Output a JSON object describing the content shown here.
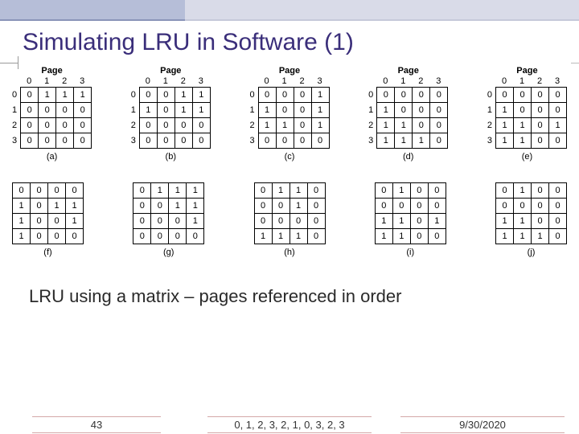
{
  "title": "Simulating LRU in Software (1)",
  "page_label": "Page",
  "cols": [
    "0",
    "1",
    "2",
    "3"
  ],
  "rows": [
    "0",
    "1",
    "2",
    "3"
  ],
  "matrices": {
    "top": [
      {
        "cap": "(a)",
        "m": [
          [
            "0",
            "1",
            "1",
            "1"
          ],
          [
            "0",
            "0",
            "0",
            "0"
          ],
          [
            "0",
            "0",
            "0",
            "0"
          ],
          [
            "0",
            "0",
            "0",
            "0"
          ]
        ]
      },
      {
        "cap": "(b)",
        "m": [
          [
            "0",
            "0",
            "1",
            "1"
          ],
          [
            "1",
            "0",
            "1",
            "1"
          ],
          [
            "0",
            "0",
            "0",
            "0"
          ],
          [
            "0",
            "0",
            "0",
            "0"
          ]
        ]
      },
      {
        "cap": "(c)",
        "m": [
          [
            "0",
            "0",
            "0",
            "1"
          ],
          [
            "1",
            "0",
            "0",
            "1"
          ],
          [
            "1",
            "1",
            "0",
            "1"
          ],
          [
            "0",
            "0",
            "0",
            "0"
          ]
        ]
      },
      {
        "cap": "(d)",
        "m": [
          [
            "0",
            "0",
            "0",
            "0"
          ],
          [
            "1",
            "0",
            "0",
            "0"
          ],
          [
            "1",
            "1",
            "0",
            "0"
          ],
          [
            "1",
            "1",
            "1",
            "0"
          ]
        ]
      },
      {
        "cap": "(e)",
        "m": [
          [
            "0",
            "0",
            "0",
            "0"
          ],
          [
            "1",
            "0",
            "0",
            "0"
          ],
          [
            "1",
            "1",
            "0",
            "1"
          ],
          [
            "1",
            "1",
            "0",
            "0"
          ]
        ]
      }
    ],
    "bot": [
      {
        "cap": "(f)",
        "m": [
          [
            "0",
            "0",
            "0",
            "0"
          ],
          [
            "1",
            "0",
            "1",
            "1"
          ],
          [
            "1",
            "0",
            "0",
            "1"
          ],
          [
            "1",
            "0",
            "0",
            "0"
          ]
        ]
      },
      {
        "cap": "(g)",
        "m": [
          [
            "0",
            "1",
            "1",
            "1"
          ],
          [
            "0",
            "0",
            "1",
            "1"
          ],
          [
            "0",
            "0",
            "0",
            "1"
          ],
          [
            "0",
            "0",
            "0",
            "0"
          ]
        ]
      },
      {
        "cap": "(h)",
        "m": [
          [
            "0",
            "1",
            "1",
            "0"
          ],
          [
            "0",
            "0",
            "1",
            "0"
          ],
          [
            "0",
            "0",
            "0",
            "0"
          ],
          [
            "1",
            "1",
            "1",
            "0"
          ]
        ]
      },
      {
        "cap": "(i)",
        "m": [
          [
            "0",
            "1",
            "0",
            "0"
          ],
          [
            "0",
            "0",
            "0",
            "0"
          ],
          [
            "1",
            "1",
            "0",
            "1"
          ],
          [
            "1",
            "1",
            "0",
            "0"
          ]
        ]
      },
      {
        "cap": "(j)",
        "m": [
          [
            "0",
            "1",
            "0",
            "0"
          ],
          [
            "0",
            "0",
            "0",
            "0"
          ],
          [
            "1",
            "1",
            "0",
            "0"
          ],
          [
            "1",
            "1",
            "1",
            "0"
          ]
        ]
      }
    ]
  },
  "subtitle": "LRU using a matrix – pages referenced in order",
  "footer": {
    "page": "43",
    "seq": "0, 1, 2, 3, 2, 1, 0, 3, 2, 3",
    "date": "9/30/2020"
  },
  "chart_data": {
    "type": "table",
    "description": "Ten 4x4 binary matrices representing LRU simulation states after referencing pages in sequence.",
    "reference_sequence": [
      0,
      1,
      2,
      3,
      2,
      1,
      0,
      3,
      2,
      3
    ],
    "states": [
      {
        "label": "(a)",
        "after_ref": 0,
        "matrix": [
          [
            0,
            1,
            1,
            1
          ],
          [
            0,
            0,
            0,
            0
          ],
          [
            0,
            0,
            0,
            0
          ],
          [
            0,
            0,
            0,
            0
          ]
        ]
      },
      {
        "label": "(b)",
        "after_ref": 1,
        "matrix": [
          [
            0,
            0,
            1,
            1
          ],
          [
            1,
            0,
            1,
            1
          ],
          [
            0,
            0,
            0,
            0
          ],
          [
            0,
            0,
            0,
            0
          ]
        ]
      },
      {
        "label": "(c)",
        "after_ref": 2,
        "matrix": [
          [
            0,
            0,
            0,
            1
          ],
          [
            1,
            0,
            0,
            1
          ],
          [
            1,
            1,
            0,
            1
          ],
          [
            0,
            0,
            0,
            0
          ]
        ]
      },
      {
        "label": "(d)",
        "after_ref": 3,
        "matrix": [
          [
            0,
            0,
            0,
            0
          ],
          [
            1,
            0,
            0,
            0
          ],
          [
            1,
            1,
            0,
            0
          ],
          [
            1,
            1,
            1,
            0
          ]
        ]
      },
      {
        "label": "(e)",
        "after_ref": 2,
        "matrix": [
          [
            0,
            0,
            0,
            0
          ],
          [
            1,
            0,
            0,
            0
          ],
          [
            1,
            1,
            0,
            1
          ],
          [
            1,
            1,
            0,
            0
          ]
        ]
      },
      {
        "label": "(f)",
        "after_ref": 1,
        "matrix": [
          [
            0,
            0,
            0,
            0
          ],
          [
            1,
            0,
            1,
            1
          ],
          [
            1,
            0,
            0,
            1
          ],
          [
            1,
            0,
            0,
            0
          ]
        ]
      },
      {
        "label": "(g)",
        "after_ref": 0,
        "matrix": [
          [
            0,
            1,
            1,
            1
          ],
          [
            0,
            0,
            1,
            1
          ],
          [
            0,
            0,
            0,
            1
          ],
          [
            0,
            0,
            0,
            0
          ]
        ]
      },
      {
        "label": "(h)",
        "after_ref": 3,
        "matrix": [
          [
            0,
            1,
            1,
            0
          ],
          [
            0,
            0,
            1,
            0
          ],
          [
            0,
            0,
            0,
            0
          ],
          [
            1,
            1,
            1,
            0
          ]
        ]
      },
      {
        "label": "(i)",
        "after_ref": 2,
        "matrix": [
          [
            0,
            1,
            0,
            0
          ],
          [
            0,
            0,
            0,
            0
          ],
          [
            1,
            1,
            0,
            1
          ],
          [
            1,
            1,
            0,
            0
          ]
        ]
      },
      {
        "label": "(j)",
        "after_ref": 3,
        "matrix": [
          [
            0,
            1,
            0,
            0
          ],
          [
            0,
            0,
            0,
            0
          ],
          [
            1,
            1,
            0,
            0
          ],
          [
            1,
            1,
            1,
            0
          ]
        ]
      }
    ]
  }
}
